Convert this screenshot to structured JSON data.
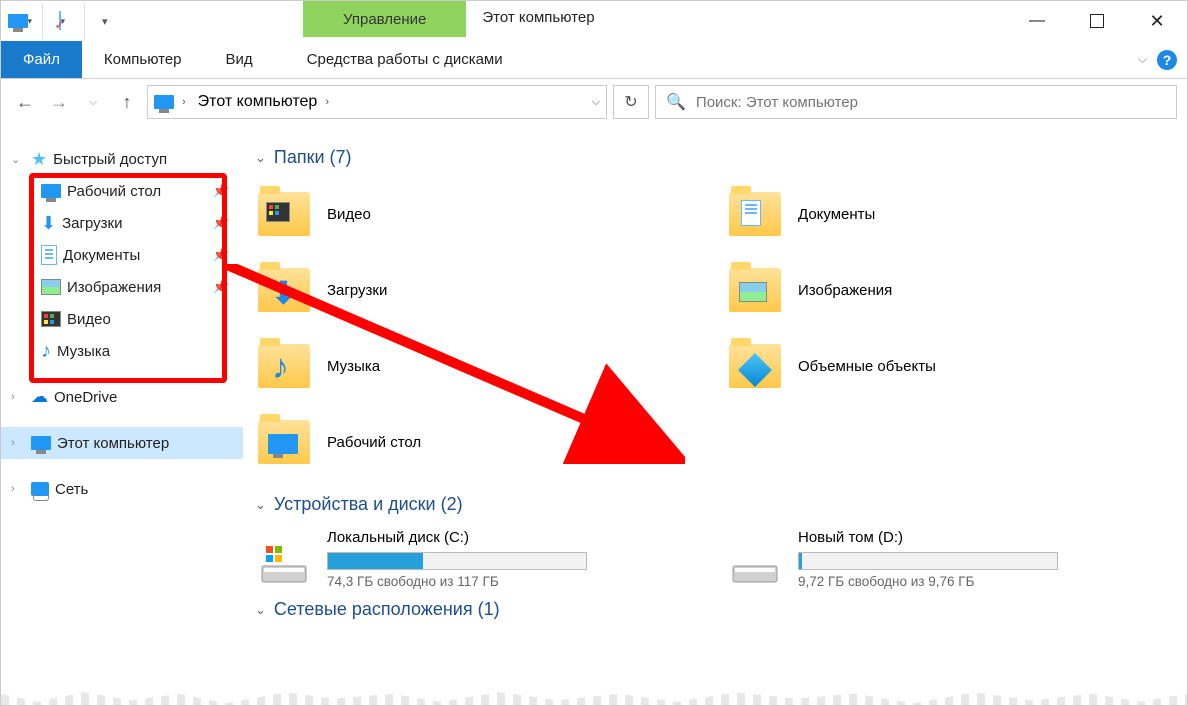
{
  "window": {
    "title": "Этот компьютер",
    "manage_tab": "Управление",
    "context_tab": "Средства работы с дисками"
  },
  "ribbon": {
    "file": "Файл",
    "tabs": [
      "Компьютер",
      "Вид"
    ]
  },
  "addressbar": {
    "location": "Этот компьютер",
    "separator": "›"
  },
  "search": {
    "placeholder": "Поиск: Этот компьютер"
  },
  "sidebar": {
    "quick_access": "Быстрый доступ",
    "items": [
      {
        "label": "Рабочий стол",
        "icon": "monitor"
      },
      {
        "label": "Загрузки",
        "icon": "download"
      },
      {
        "label": "Документы",
        "icon": "document"
      },
      {
        "label": "Изображения",
        "icon": "image"
      },
      {
        "label": "Видео",
        "icon": "video"
      },
      {
        "label": "Музыка",
        "icon": "music"
      }
    ],
    "onedrive": "OneDrive",
    "this_pc": "Этот компьютер",
    "network": "Сеть"
  },
  "sections": {
    "folders": {
      "title": "Папки",
      "count": 7
    },
    "drives": {
      "title": "Устройства и диски",
      "count": 2
    },
    "netloc": {
      "title": "Сетевые расположения",
      "count": 1
    }
  },
  "folders": [
    {
      "label": "Видео"
    },
    {
      "label": "Документы"
    },
    {
      "label": "Загрузки"
    },
    {
      "label": "Изображения"
    },
    {
      "label": "Музыка"
    },
    {
      "label": "Объемные объекты"
    },
    {
      "label": "Рабочий стол"
    }
  ],
  "drives": [
    {
      "name": "Локальный диск (C:)",
      "free_text": "74,3 ГБ свободно из 117 ГБ",
      "fill_pct": 37
    },
    {
      "name": "Новый том (D:)",
      "free_text": "9,72 ГБ свободно из 9,76 ГБ",
      "fill_pct": 1
    }
  ]
}
